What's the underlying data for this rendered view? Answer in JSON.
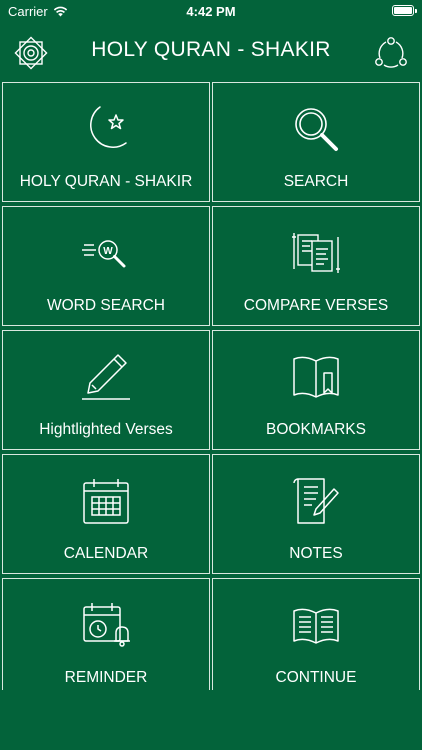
{
  "status_bar": {
    "carrier": "Carrier",
    "time": "4:42 PM"
  },
  "nav": {
    "title": "HOLY QURAN - SHAKIR",
    "left_icon": "settings-gear-icon",
    "right_icon": "share-icon"
  },
  "tiles": [
    {
      "label": "HOLY QURAN - SHAKIR",
      "icon": "crescent-star-icon"
    },
    {
      "label": "SEARCH",
      "icon": "magnifier-icon"
    },
    {
      "label": "WORD SEARCH",
      "icon": "word-search-icon"
    },
    {
      "label": "COMPARE VERSES",
      "icon": "compare-documents-icon"
    },
    {
      "label": "Hightlighted Verses",
      "icon": "highlighter-pen-icon"
    },
    {
      "label": "BOOKMARKS",
      "icon": "bookmark-book-icon"
    },
    {
      "label": "CALENDAR",
      "icon": "calendar-icon"
    },
    {
      "label": "NOTES",
      "icon": "notes-pen-icon"
    },
    {
      "label": "REMINDER",
      "icon": "reminder-clock-bell-icon"
    },
    {
      "label": "CONTINUE",
      "icon": "open-book-icon"
    }
  ],
  "colors": {
    "background": "#03633a",
    "border": "#d9e8df",
    "text": "#ffffff"
  }
}
